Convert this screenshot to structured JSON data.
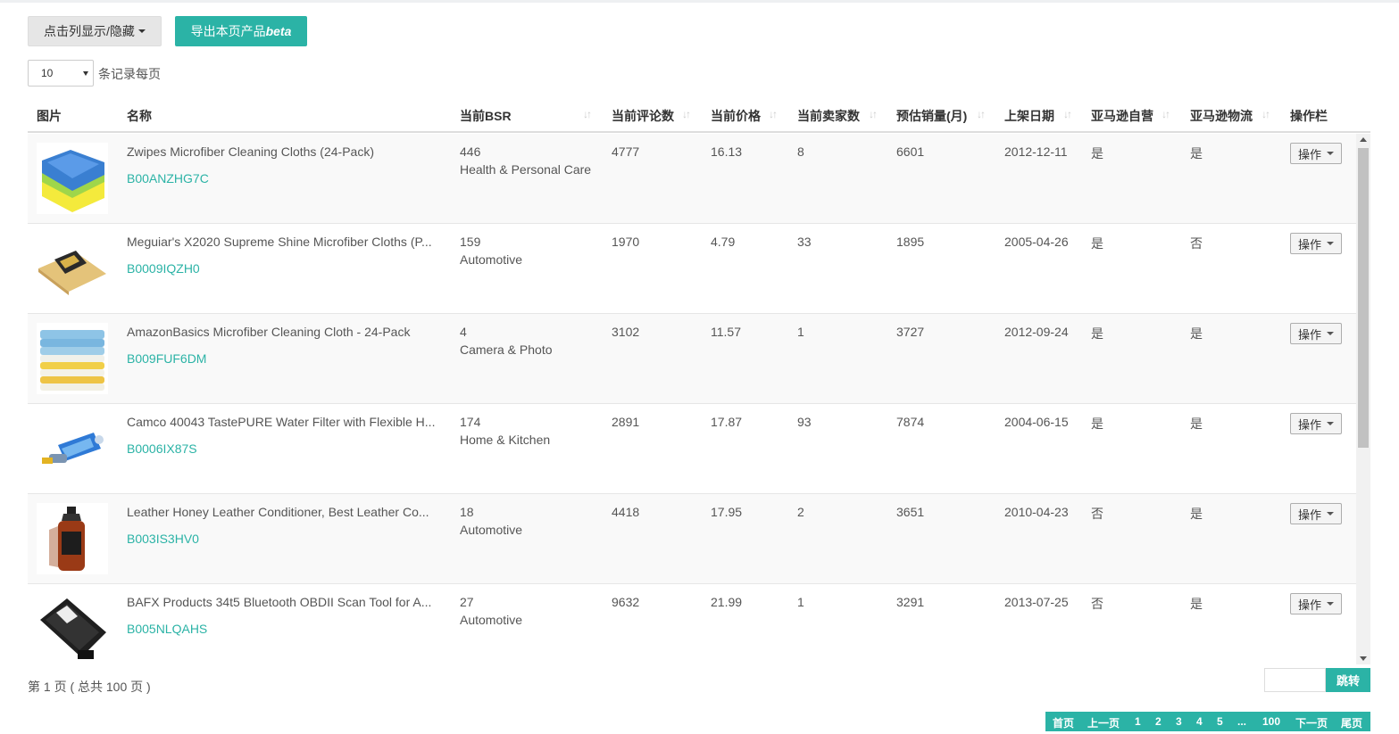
{
  "toolbar": {
    "toggle_columns_label": "点击列显示/隐藏",
    "export_label": "导出本页产品",
    "export_badge": "beta"
  },
  "pagesize": {
    "value": "10",
    "label": "条记录每页"
  },
  "columns": [
    "图片",
    "名称",
    "当前BSR",
    "当前评论数",
    "当前价格",
    "当前卖家数",
    "预估销量(月)",
    "上架日期",
    "亚马逊自营",
    "亚马逊物流",
    "操作栏"
  ],
  "rows": [
    {
      "name": "Zwipes Microfiber Cleaning Cloths (24-Pack)",
      "asin": "B00ANZHG7C",
      "bsr": "446",
      "category": "Health & Personal Care",
      "reviews": "4777",
      "price": "16.13",
      "sellers": "8",
      "sales": "6601",
      "date": "2012-12-11",
      "amazon_self": "是",
      "fba": "是",
      "op": "操作"
    },
    {
      "name": "Meguiar's X2020 Supreme Shine Microfiber Cloths (P...",
      "asin": "B0009IQZH0",
      "bsr": "159",
      "category": "Automotive",
      "reviews": "1970",
      "price": "4.79",
      "sellers": "33",
      "sales": "1895",
      "date": "2005-04-26",
      "amazon_self": "是",
      "fba": "否",
      "op": "操作"
    },
    {
      "name": "AmazonBasics Microfiber Cleaning Cloth - 24-Pack",
      "asin": "B009FUF6DM",
      "bsr": "4",
      "category": "Camera & Photo",
      "reviews": "3102",
      "price": "11.57",
      "sellers": "1",
      "sales": "3727",
      "date": "2012-09-24",
      "amazon_self": "是",
      "fba": "是",
      "op": "操作"
    },
    {
      "name": "Camco 40043 TastePURE Water Filter with Flexible H...",
      "asin": "B0006IX87S",
      "bsr": "174",
      "category": "Home & Kitchen",
      "reviews": "2891",
      "price": "17.87",
      "sellers": "93",
      "sales": "7874",
      "date": "2004-06-15",
      "amazon_self": "是",
      "fba": "是",
      "op": "操作"
    },
    {
      "name": "Leather Honey Leather Conditioner, Best Leather Co...",
      "asin": "B003IS3HV0",
      "bsr": "18",
      "category": "Automotive",
      "reviews": "4418",
      "price": "17.95",
      "sellers": "2",
      "sales": "3651",
      "date": "2010-04-23",
      "amazon_self": "否",
      "fba": "是",
      "op": "操作"
    },
    {
      "name": "BAFX Products 34t5 Bluetooth OBDII Scan Tool for A...",
      "asin": "B005NLQAHS",
      "bsr": "27",
      "category": "Automotive",
      "reviews": "9632",
      "price": "21.99",
      "sellers": "1",
      "sales": "3291",
      "date": "2013-07-25",
      "amazon_self": "否",
      "fba": "是",
      "op": "操作"
    }
  ],
  "footer": {
    "page_info": "第 1 页 ( 总共 100 页 )",
    "jump_label": "跳转",
    "pager": [
      "首页",
      "上一页",
      "1",
      "2",
      "3",
      "4",
      "5",
      "...",
      "100",
      "下一页",
      "尾页"
    ]
  },
  "colors": {
    "accent": "#2bb3a6",
    "stripe": "#f9f9f9"
  }
}
